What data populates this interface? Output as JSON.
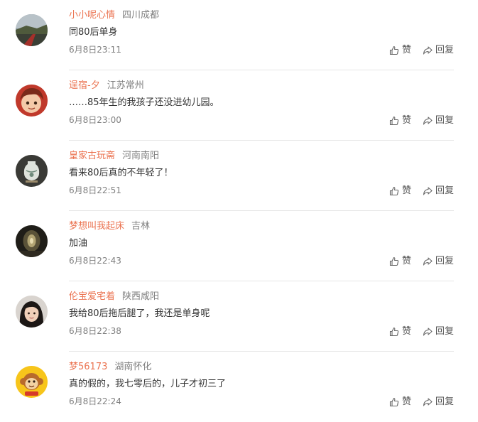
{
  "labels": {
    "like": "赞",
    "reply": "回复"
  },
  "colors": {
    "name": "#eb7350",
    "meta": "#808080",
    "text": "#333333",
    "divider": "#e6e6e6"
  },
  "comments": [
    {
      "name": "小小呢心情",
      "location": "四川成都",
      "text": "同80后单身",
      "time": "6月8日23:11",
      "avatar": "landscape-avatar"
    },
    {
      "name": "逞宿-夕",
      "location": "江苏常州",
      "text": "……85年生的我孩子还没进幼儿园。",
      "time": "6月8日23:00",
      "avatar": "cartoon-girl-avatar"
    },
    {
      "name": "皇家古玩斋",
      "location": "河南南阳",
      "text": "看来80后真的不年轻了！",
      "time": "6月8日22:51",
      "avatar": "antique-vase-avatar"
    },
    {
      "name": "梦想叫我起床",
      "location": "吉林",
      "text": "加油",
      "time": "6月8日22:43",
      "avatar": "tunnel-avatar"
    },
    {
      "name": "伦宝爱宅着",
      "location": "陕西咸阳",
      "text": "我给80后拖后腿了，我还是单身呢",
      "time": "6月8日22:38",
      "avatar": "girl-photo-avatar"
    },
    {
      "name": "梦56173",
      "location": "湖南怀化",
      "text": "真的假的，我七零后的，儿子才初三了",
      "time": "6月8日22:24",
      "avatar": "monkey-avatar"
    }
  ]
}
